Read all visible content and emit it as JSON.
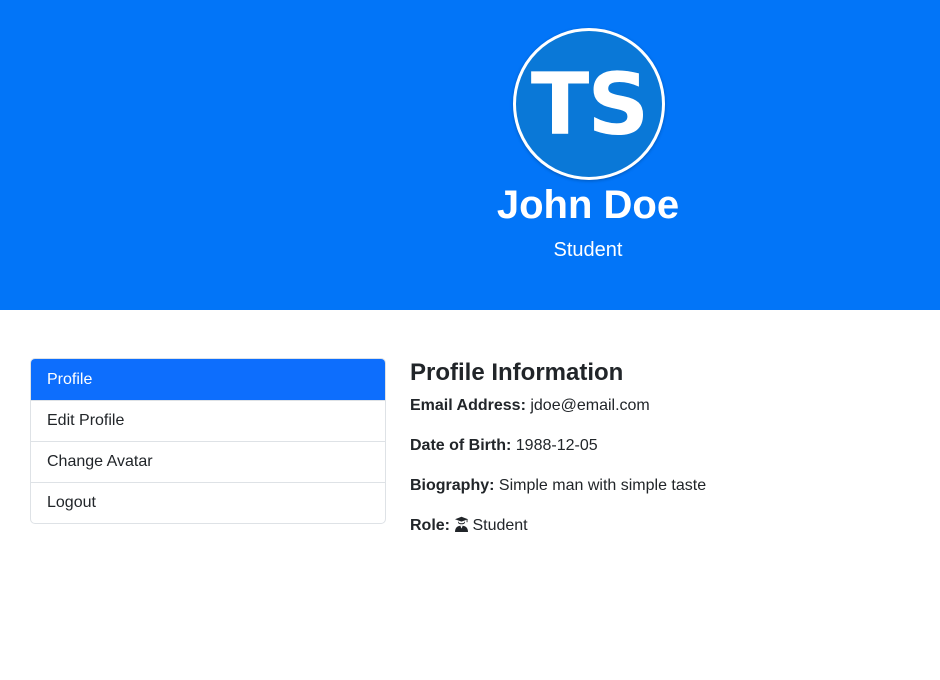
{
  "hero": {
    "avatar_initials": "TS",
    "name": "John Doe",
    "role": "Student",
    "background_color": "#0275f8",
    "avatar_color": "#0a78d7"
  },
  "menu": {
    "items": [
      {
        "label": "Profile",
        "active": true
      },
      {
        "label": "Edit Profile",
        "active": false
      },
      {
        "label": "Change Avatar",
        "active": false
      },
      {
        "label": "Logout",
        "active": false
      }
    ],
    "active_color": "#0d6efd"
  },
  "profile": {
    "title": "Profile Information",
    "fields": [
      {
        "label": "Email Address:",
        "value": "jdoe@email.com"
      },
      {
        "label": "Date of Birth:",
        "value": "1988-12-05"
      },
      {
        "label": "Biography:",
        "value": "Simple man with simple taste"
      },
      {
        "label": "Role:",
        "value": "Student",
        "icon": "graduate-icon"
      }
    ]
  }
}
